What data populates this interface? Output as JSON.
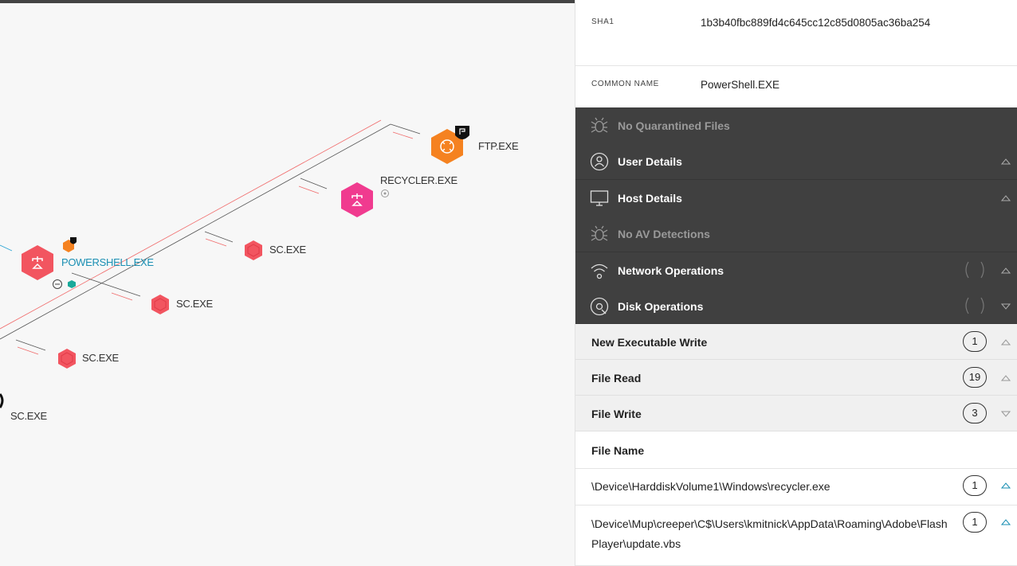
{
  "graph": {
    "nodes": {
      "ftp": {
        "label": "FTP.EXE",
        "color": "#f58220"
      },
      "recycler": {
        "label": "RECYCLER.EXE",
        "color": "#f03b8f"
      },
      "powershell": {
        "label": "POWERSHELL.EXE",
        "color": "#f25560"
      },
      "sc1": {
        "label": "SC.EXE",
        "color": "#f25560"
      },
      "sc2": {
        "label": "SC.EXE",
        "color": "#f25560"
      },
      "sc3": {
        "label": "SC.EXE",
        "color": "#f25560"
      },
      "sc4": {
        "label": "SC.EXE"
      }
    }
  },
  "details": {
    "sha1": {
      "key": "SHA1",
      "value": "1b3b40fbc889fd4c645cc12c85d0805ac36ba254"
    },
    "common_name": {
      "key": "COMMON NAME",
      "value": "PowerShell.EXE"
    }
  },
  "sections": {
    "quarantined": {
      "label": "No Quarantined Files",
      "icon": "bug-icon"
    },
    "user": {
      "label": "User Details",
      "icon": "user-icon"
    },
    "host": {
      "label": "Host Details",
      "icon": "monitor-icon"
    },
    "av": {
      "label": "No AV Detections",
      "icon": "bug-icon"
    },
    "network": {
      "label": "Network Operations",
      "icon": "wifi-icon"
    },
    "disk": {
      "label": "Disk Operations",
      "icon": "disk-icon"
    }
  },
  "disk_ops": {
    "new_exec_write": {
      "label": "New Executable Write",
      "count": "1"
    },
    "file_read": {
      "label": "File Read",
      "count": "19"
    },
    "file_write": {
      "label": "File Write",
      "count": "3"
    }
  },
  "file_table": {
    "header": "File Name",
    "rows": [
      {
        "path": "\\Device\\HarddiskVolume1\\Windows\\recycler.exe",
        "count": "1"
      },
      {
        "path": "\\Device\\Mup\\creeper\\C$\\Users\\kmitnick\\AppData\\Roaming\\Adobe\\Flash Player\\update.vbs",
        "count": "1"
      }
    ]
  },
  "colors": {
    "accent_blue": "#1a8fb3",
    "dark_section": "#404040",
    "teal": "#19a99a"
  }
}
